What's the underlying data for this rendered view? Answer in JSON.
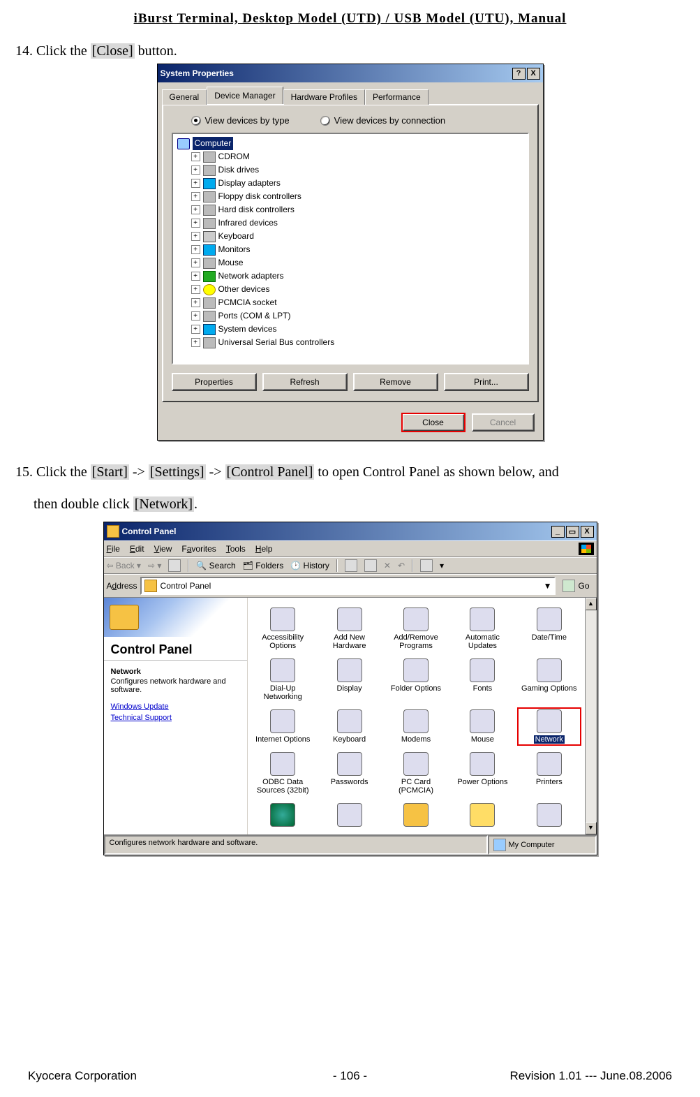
{
  "header": "iBurst Terminal, Desktop Model (UTD) / USB Model (UTU), Manual",
  "step14": {
    "num": "14. ",
    "pre": "Click the ",
    "hl": "[Close]",
    "post": " button."
  },
  "step15": {
    "num": "15. ",
    "pre": "Click the ",
    "hl1": "[Start]",
    "a": " -> ",
    "hl2": "[Settings]",
    "b": " -> ",
    "hl3": "[Control Panel]",
    "mid": " to open Control Panel as shown below, and",
    "line2_pre": "then double click ",
    "hl4": "[Network]",
    "line2_post": "."
  },
  "sysprops": {
    "title": "System Properties",
    "tabs": [
      "General",
      "Device Manager",
      "Hardware Profiles",
      "Performance"
    ],
    "activeTab": 1,
    "radios": [
      "View devices by type",
      "View devices by connection"
    ],
    "root": "Computer",
    "devices": [
      "CDROM",
      "Disk drives",
      "Display adapters",
      "Floppy disk controllers",
      "Hard disk controllers",
      "Infrared devices",
      "Keyboard",
      "Monitors",
      "Mouse",
      "Network adapters",
      "Other devices",
      "PCMCIA socket",
      "Ports (COM & LPT)",
      "System devices",
      "Universal Serial Bus controllers"
    ],
    "btns": {
      "prop": "Properties",
      "refresh": "Refresh",
      "remove": "Remove",
      "print": "Print..."
    },
    "dlgBtns": {
      "close": "Close",
      "cancel": "Cancel"
    },
    "help": "?",
    "x": "X"
  },
  "cp": {
    "title": "Control Panel",
    "menus": {
      "file": "File",
      "edit": "Edit",
      "view": "View",
      "fav": "Favorites",
      "tools": "Tools",
      "help": "Help"
    },
    "toolbar": {
      "back": "Back",
      "search": "Search",
      "folders": "Folders",
      "history": "History"
    },
    "addrLabel": "Address",
    "addrVal": "Control Panel",
    "go": "Go",
    "sideTitle": "Control Panel",
    "descHead": "Network",
    "descBody": "Configures network hardware and software.",
    "links": [
      "Windows Update",
      "Technical Support"
    ],
    "items": [
      "Accessibility Options",
      "Add New Hardware",
      "Add/Remove Programs",
      "Automatic Updates",
      "Date/Time",
      "Dial-Up Networking",
      "Display",
      "Folder Options",
      "Fonts",
      "Gaming Options",
      "Internet Options",
      "Keyboard",
      "Modems",
      "Mouse",
      "Network",
      "ODBC Data Sources (32bit)",
      "Passwords",
      "PC Card (PCMCIA)",
      "Power Options",
      "Printers"
    ],
    "selectedIndex": 14,
    "status": "Configures network hardware and software.",
    "statusRight": "My Computer",
    "min": "_",
    "max": "▭",
    "x": "X"
  },
  "footer": {
    "left": "Kyocera Corporation",
    "page": "- 106 -",
    "right": "Revision 1.01 --- June.08.2006"
  }
}
